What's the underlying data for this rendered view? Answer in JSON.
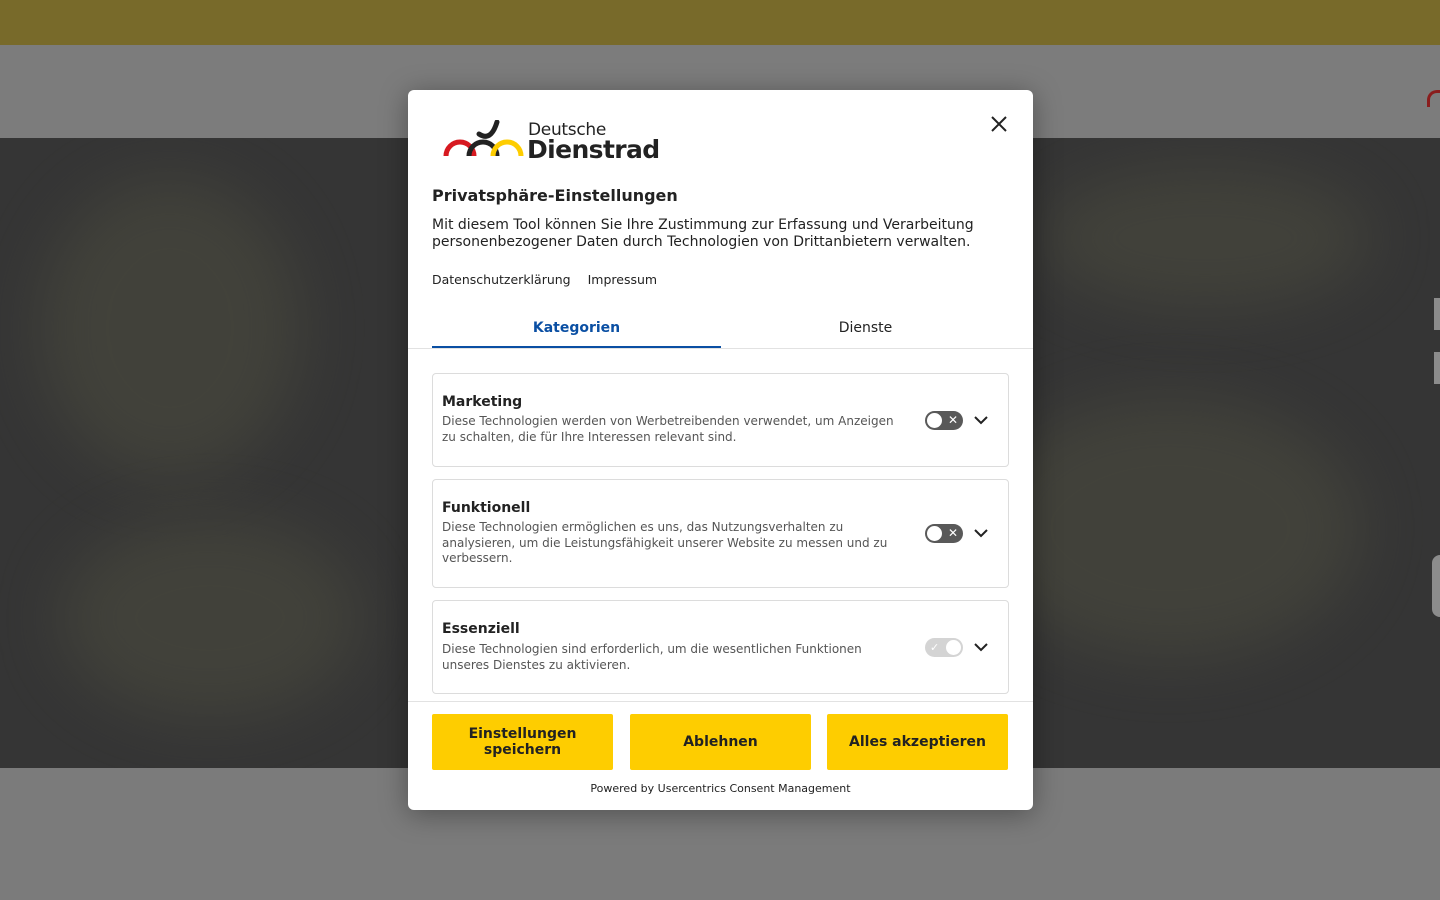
{
  "modal": {
    "brand_line1": "Deutsche",
    "brand_line2": "Dienstrad",
    "title": "Privatsphäre-Einstellungen",
    "description": "Mit diesem Tool können Sie Ihre Zustimmung zur Erfassung und Verarbeitung personenbezogener Daten durch Technologien von Drittanbietern verwalten.",
    "links": [
      "Datenschutzerklärung",
      "Impressum"
    ],
    "tabs": [
      {
        "label": "Kategorien",
        "active": true
      },
      {
        "label": "Dienste",
        "active": false
      }
    ],
    "categories": [
      {
        "title": "Marketing",
        "description": "Diese Technologien werden von Werbetreibenden verwendet, um Anzeigen zu schalten, die für Ihre Interessen relevant sind.",
        "enabled": false,
        "locked": false
      },
      {
        "title": "Funktionell",
        "description": "Diese Technologien ermöglichen es uns, das Nutzungsverhalten zu analysieren, um die Leistungsfähigkeit unserer Website zu messen und zu verbessern.",
        "enabled": false,
        "locked": false
      },
      {
        "title": "Essenziell",
        "description": "Diese Technologien sind erforderlich, um die wesentlichen Funktionen unseres Dienstes zu aktivieren.",
        "enabled": true,
        "locked": true
      }
    ],
    "buttons": {
      "save": "Einstellungen speichern",
      "deny": "Ablehnen",
      "accept_all": "Alles akzeptieren"
    },
    "powered_by": "Powered by Usercentrics Consent Management"
  },
  "colors": {
    "accent_blue": "#0a4fa3",
    "button_yellow": "#fecd00",
    "toggle_off": "#595959",
    "toggle_locked": "#d4d4d4"
  },
  "icons": {
    "close": "close-icon",
    "chevron": "chevron-down-icon",
    "toggle_off_mark": "✕",
    "toggle_on_mark": "✓"
  }
}
